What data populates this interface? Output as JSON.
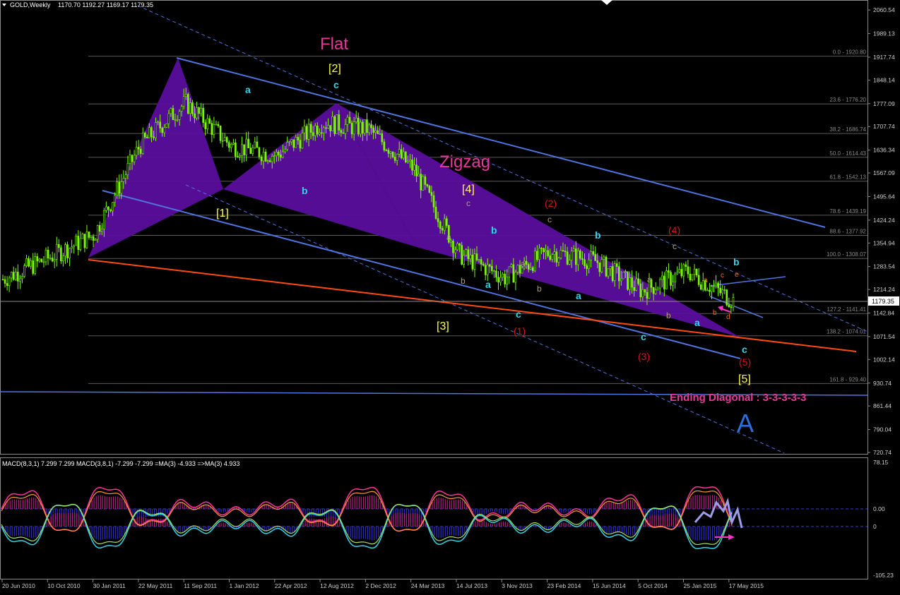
{
  "header": {
    "menu_icon": "triangle-down-icon",
    "symbol": "GOLD,Weekly",
    "ohlc": "1170.70 1192.27 1169.17 1179.35"
  },
  "indicator": {
    "label": "MACD(8,3,1) 7.299 7.299  MACD(3,8,1) -7.299 -7.299  =MA(3) -4.933  =>MA(3) 4.933"
  },
  "current_price": "1179.35",
  "price_axis_labels": [
    "2060.54",
    "1989.13",
    "1917.74",
    "1848.14",
    "1777.09",
    "1707.74",
    "1636.34",
    "1567.09",
    "1495.64",
    "1424.24",
    "1354.94",
    "1283.54",
    "1214.24",
    "1142.84",
    "1071.54",
    "1002.14",
    "930.74",
    "861.44",
    "790.04",
    "720.74"
  ],
  "macd_axis_labels": [
    "78.15",
    "0.00",
    "0",
    "-105.23"
  ],
  "date_labels": [
    "20 Jun 2010",
    "10 Oct 2010",
    "30 Jan 2011",
    "22 May 2011",
    "11 Sep 2011",
    "1 Jan 2012",
    "22 Apr 2012",
    "12 Aug 2012",
    "2 Dec 2012",
    "24 Mar 2013",
    "14 Jul 2013",
    "3 Nov 2013",
    "23 Feb 2014",
    "15 Jun 2014",
    "5 Oct 2014",
    "25 Jan 2015",
    "17 May 2015"
  ],
  "fib_levels": [
    {
      "label": "0.0 - 1920.80",
      "value": 1920.8
    },
    {
      "label": "23.6 - 1776.20",
      "value": 1776.2
    },
    {
      "label": "38.2 - 1686.74",
      "value": 1686.74
    },
    {
      "label": "50.0 - 1614.43",
      "value": 1614.43
    },
    {
      "label": "61.8 - 1542.13",
      "value": 1542.13
    },
    {
      "label": "78.6 - 1439.19",
      "value": 1439.19
    },
    {
      "label": "88.6 - 1377.92",
      "value": 1377.92
    },
    {
      "label": "100.0 - 1308.07",
      "value": 1308.07
    },
    {
      "label": "127.2 - 1141.41",
      "value": 1141.41
    },
    {
      "label": "138.2 - 1074.01",
      "value": 1074.01
    },
    {
      "label": "161.8 - 929.40",
      "value": 929.4
    }
  ],
  "annotations": {
    "flat": "Flat",
    "zigzag": "Zigzag",
    "ending_diagonal": "Ending Diagonal : 3-3-3-3-3",
    "big_a": "A",
    "w1": "[1]",
    "w2": "[2]",
    "w3": "[3]",
    "w4": "[4]",
    "w5": "[5]",
    "p1": "(1)",
    "p2": "(2)",
    "p3": "(3)",
    "p4": "(4)",
    "p5": "(5)",
    "a": "a",
    "b": "b",
    "c": "c",
    "d": "d",
    "e": "e"
  },
  "colors": {
    "background": "#000000",
    "candle": "#7CFC00",
    "channel": "#4F74E0",
    "trendline": "#FF4A10",
    "triangle_fill": "#5B0E9E",
    "magenta": "#E8389A",
    "yellow": "#FFFF4D",
    "cyan": "#33D6E8",
    "red_count": "#D81414",
    "grey_count": "#A9A07A",
    "orange_count": "#FF6A22",
    "fib_line": "#5A5A5A",
    "axis_text": "#D0D0D0",
    "big_a": "#2B6FD8"
  },
  "chart_data": {
    "type": "line",
    "title": "GOLD,Weekly",
    "xlabel": "",
    "ylabel": "",
    "ylim": [
      680,
      2090
    ],
    "x": [
      "20 Jun 2010",
      "10 Oct 2010",
      "30 Jan 2011",
      "22 May 2011",
      "11 Sep 2011",
      "1 Jan 2012",
      "22 Apr 2012",
      "12 Aug 2012",
      "2 Dec 2012",
      "24 Mar 2013",
      "14 Jul 2013",
      "3 Nov 2013",
      "23 Feb 2014",
      "15 Jun 2014",
      "5 Oct 2014",
      "25 Jan 2015",
      "17 May 2015"
    ],
    "series": [
      {
        "values": [
          1245,
          1310,
          1380,
          1650,
          1780,
          1650,
          1620,
          1720,
          1700,
          1580,
          1320,
          1250,
          1330,
          1300,
          1210,
          1270,
          1180
        ]
      }
    ],
    "grid": false,
    "legend": "none"
  }
}
